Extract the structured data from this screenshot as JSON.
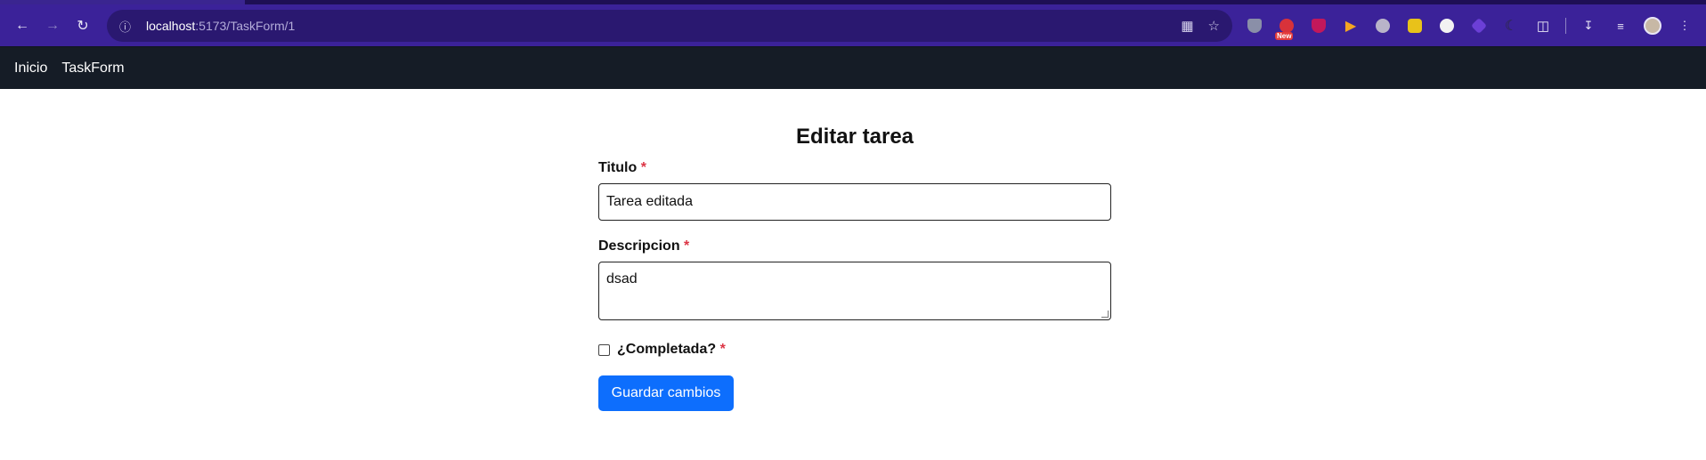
{
  "browser": {
    "url_host": "localhost",
    "url_path": ":5173/TaskForm/1",
    "extension_badge": "New",
    "icons": {
      "back": "back-arrow-icon",
      "forward": "forward-arrow-icon",
      "reload": "reload-icon",
      "site_info": "site-info-icon",
      "translate": "translate-icon",
      "bookmark": "star-icon"
    }
  },
  "navbar": {
    "items": [
      {
        "label": "Inicio"
      },
      {
        "label": "TaskForm"
      }
    ]
  },
  "form": {
    "title": "Editar tarea",
    "titulo_label": "Titulo",
    "titulo_value": "Tarea editada",
    "descripcion_label": "Descripcion",
    "descripcion_value": "dsad",
    "required_mark": "*",
    "completada_label": "¿Completada?",
    "completada_checked": false,
    "submit_label": "Guardar cambios"
  },
  "colors": {
    "browser_toolbar": "#3b2299",
    "app_navbar": "#151c26",
    "primary_button": "#0d6efd",
    "required": "#dc3545"
  }
}
